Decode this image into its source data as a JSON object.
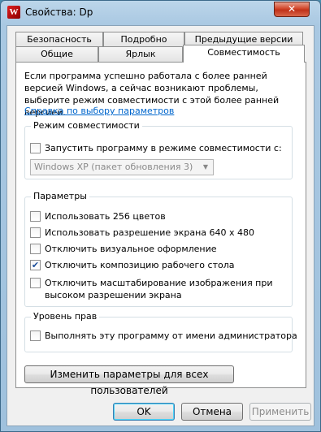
{
  "window": {
    "title": "Свойства: Dp",
    "close": "✕",
    "app_icon": "W"
  },
  "tabs_row1": [
    "Безопасность",
    "Подробно",
    "Предыдущие версии"
  ],
  "tabs_row2": [
    "Общие",
    "Ярлык",
    "Совместимость"
  ],
  "intro": "Если программа успешно работала с более ранней версией Windows, а сейчас возникают проблемы, выберите режим совместимости с этой более ранней версией.",
  "help_link": "Справка по выбору параметров",
  "compat_mode": {
    "title": "Режим совместимости",
    "checkbox": "Запустить программу в режиме совместимости с:",
    "select_value": "Windows XP (пакет обновления 3)"
  },
  "settings": {
    "title": "Параметры",
    "items": [
      {
        "label": "Использовать 256 цветов",
        "checked": false
      },
      {
        "label": "Использовать разрешение экрана 640 x 480",
        "checked": false
      },
      {
        "label": "Отключить визуальное оформление",
        "checked": false
      },
      {
        "label": "Отключить композицию рабочего стола",
        "checked": true
      },
      {
        "label": "Отключить масштабирование изображения при высоком разрешении экрана",
        "checked": false
      }
    ]
  },
  "privilege": {
    "title": "Уровень прав",
    "checkbox": "Выполнять эту программу от имени администратора"
  },
  "all_users_button": "Изменить параметры для всех пользователей",
  "buttons": {
    "ok": "OK",
    "cancel": "Отмена",
    "apply": "Применить"
  },
  "colors": {
    "link": "#0066cc",
    "close": "#c0321a",
    "check": "#1c4e9a"
  }
}
